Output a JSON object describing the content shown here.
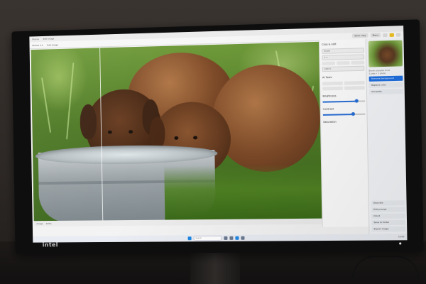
{
  "monitor": {
    "brand": "intel"
  },
  "app": {
    "titlebar": {
      "app_name": "Photos",
      "tab": "Edit Image"
    },
    "toolbar": {
      "items": [
        "Photos 3.1",
        "Edit Image"
      ],
      "save_label": "Save copy",
      "more_label": "Menu"
    },
    "panel": {
      "title": "Crop & edit",
      "size_label": "Scale",
      "width_value": "1 x",
      "height_value": "100 %",
      "section": "AI Tools",
      "adjust_label": "Adjust",
      "rotate_label": "Rotate",
      "slider_1_label": "Brightness",
      "slider_1_value": 0.8,
      "slider_2_label": "Contrast",
      "slider_2_value": 0.7,
      "slider_3_label": "Saturation"
    },
    "sidebar": {
      "meta_1": "Brown puppies drink",
      "meta_2": "2 pets • 1 photo",
      "items": [
        "Remove background",
        "Replace color",
        "Generate"
      ],
      "bottom_items": [
        "Describe",
        "Edit prompt",
        "Cloud",
        "Save to folder",
        "Export image"
      ]
    },
    "canvas_footer": {
      "zoom": "100%",
      "info": "Image"
    },
    "taskbar": {
      "search_placeholder": "Search",
      "time": "12:00"
    }
  },
  "colors": {
    "accent": "#1f6fe0",
    "highlight": "#f0c020"
  }
}
